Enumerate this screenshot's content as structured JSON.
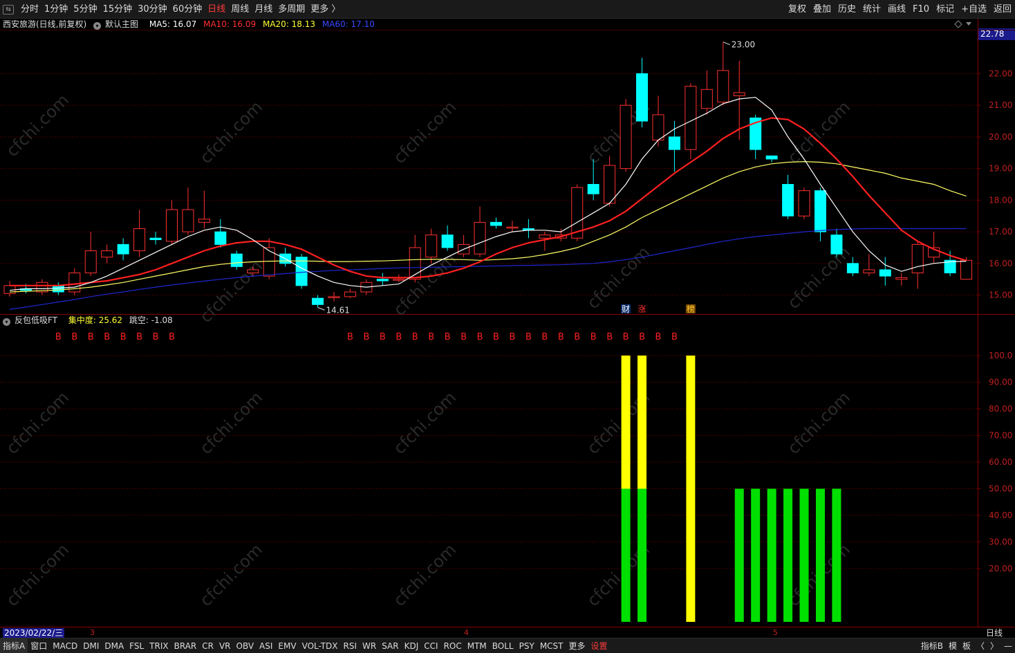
{
  "topbar": {
    "periods": [
      "分时",
      "1分钟",
      "5分钟",
      "15分钟",
      "30分钟",
      "60分钟",
      "日线",
      "周线",
      "月线",
      "多周期",
      "更多 〉"
    ],
    "active_index": 6,
    "right_tools": [
      "复权",
      "叠加",
      "历史",
      "统计",
      "画线",
      "F10",
      "标记",
      "+自选",
      "返回"
    ]
  },
  "main_panel": {
    "stock_title": "西安旅游(日线,前复权)",
    "template_name": "默认主图",
    "ma5": "MA5: 16.07",
    "ma10": "MA10: 16.09",
    "ma20": "MA20: 18.13",
    "ma60": "MA60: 17.10",
    "current_price_tag": "22.78",
    "high_label": "23.00",
    "low_label": "14.61",
    "markers": [
      "财",
      "涨",
      "榜"
    ]
  },
  "indicator_panel": {
    "name": "反包低吸FT",
    "concentration": "集中度: 25.62",
    "gap": "跳空: -1.08",
    "signal_letter": "B"
  },
  "price_axis_ticks": [
    "22.00",
    "21.00",
    "20.00",
    "19.00",
    "18.00",
    "17.00",
    "16.00",
    "15.00"
  ],
  "indicator_axis_ticks": [
    "100.0",
    "90.00",
    "80.00",
    "70.00",
    "60.00",
    "50.00",
    "40.00",
    "30.00",
    "20.00"
  ],
  "datebar": {
    "date": "2023/02/22/三",
    "months": [
      "3",
      "4",
      "5"
    ],
    "period": "日线"
  },
  "bottombar": {
    "tabs": [
      "指标A",
      "窗口",
      "MACD",
      "DMI",
      "DMA",
      "FSL",
      "TRIX",
      "BRAR",
      "CR",
      "VR",
      "OBV",
      "ASI",
      "EMV",
      "VOL-TDX",
      "RSI",
      "WR",
      "SAR",
      "KDJ",
      "CCI",
      "ROC",
      "MTM",
      "BOLL",
      "PSY",
      "MCST",
      "更多",
      "设置"
    ],
    "right": [
      "指标B",
      "模",
      "板",
      "〈",
      "〉",
      "—"
    ]
  },
  "watermark": "cfchi.com",
  "colors": {
    "up": "#ff3030",
    "down": "#00ffff",
    "ma5": "#ffffff",
    "ma10": "#ff2020",
    "ma20": "#ffff66",
    "ma60": "#1e28d0",
    "yellow_bar": "#ffff00",
    "green_bar": "#00e000",
    "grid": "#8b0000"
  },
  "chart_data": [
    {
      "type": "candlestick",
      "title": "西安旅游(日线,前复权)",
      "ylim": [
        14.4,
        23.3
      ],
      "candles": [
        [
          15.05,
          15.3,
          15.45,
          14.95
        ],
        [
          15.2,
          15.15,
          15.35,
          15.05
        ],
        [
          15.1,
          15.4,
          15.5,
          15.0
        ],
        [
          15.3,
          15.1,
          15.4,
          15.0
        ],
        [
          15.1,
          15.7,
          15.85,
          15.0
        ],
        [
          15.7,
          16.4,
          17.0,
          15.6
        ],
        [
          16.2,
          16.4,
          16.6,
          16.0
        ],
        [
          16.6,
          16.3,
          16.8,
          16.1
        ],
        [
          16.4,
          17.1,
          17.7,
          16.2
        ],
        [
          16.8,
          16.75,
          17.0,
          16.6
        ],
        [
          16.7,
          17.7,
          18.0,
          16.6
        ],
        [
          17.0,
          17.7,
          18.4,
          16.9
        ],
        [
          17.3,
          17.4,
          18.3,
          17.1
        ],
        [
          17.0,
          16.6,
          17.4,
          16.5
        ],
        [
          16.3,
          15.9,
          16.4,
          15.8
        ],
        [
          15.7,
          15.8,
          15.9,
          15.6
        ],
        [
          15.6,
          16.5,
          16.8,
          15.5
        ],
        [
          16.3,
          16.0,
          16.5,
          15.9
        ],
        [
          16.2,
          15.3,
          16.3,
          15.2
        ],
        [
          14.9,
          14.7,
          15.0,
          14.61
        ],
        [
          14.95,
          14.95,
          15.1,
          14.8
        ],
        [
          14.95,
          15.1,
          15.2,
          14.9
        ],
        [
          15.1,
          15.4,
          15.5,
          15.0
        ],
        [
          15.5,
          15.45,
          15.7,
          15.3
        ],
        [
          15.5,
          15.5,
          15.65,
          15.4
        ],
        [
          15.5,
          16.5,
          16.9,
          15.4
        ],
        [
          16.2,
          16.9,
          17.1,
          16.0
        ],
        [
          16.9,
          16.5,
          17.2,
          16.4
        ],
        [
          16.3,
          16.6,
          16.9,
          16.2
        ],
        [
          16.3,
          17.3,
          17.8,
          16.2
        ],
        [
          17.3,
          17.2,
          17.45,
          17.1
        ],
        [
          17.15,
          17.15,
          17.35,
          17.0
        ],
        [
          17.1,
          17.05,
          17.4,
          16.8
        ],
        [
          16.8,
          16.9,
          17.0,
          16.4
        ],
        [
          16.8,
          16.9,
          17.1,
          16.7
        ],
        [
          16.8,
          18.4,
          18.5,
          16.7
        ],
        [
          18.5,
          18.2,
          19.3,
          18.0
        ],
        [
          17.9,
          19.1,
          19.4,
          17.8
        ],
        [
          19.0,
          21.0,
          21.2,
          18.9
        ],
        [
          22.0,
          20.5,
          22.5,
          20.3
        ],
        [
          19.9,
          20.7,
          21.3,
          19.7
        ],
        [
          20.0,
          19.6,
          20.5,
          18.9
        ],
        [
          19.6,
          21.6,
          21.7,
          19.3
        ],
        [
          20.9,
          21.5,
          22.1,
          20.7
        ],
        [
          21.1,
          22.1,
          23.0,
          21.0
        ],
        [
          21.3,
          21.4,
          22.4,
          19.9
        ],
        [
          20.6,
          19.6,
          20.7,
          19.3
        ],
        [
          19.4,
          19.3,
          19.4,
          19.2
        ],
        [
          18.5,
          17.5,
          18.8,
          17.4
        ],
        [
          17.5,
          18.3,
          18.4,
          17.4
        ],
        [
          18.3,
          17.0,
          18.4,
          16.7
        ],
        [
          16.9,
          16.3,
          17.1,
          16.2
        ],
        [
          16.0,
          15.7,
          16.2,
          15.6
        ],
        [
          15.7,
          15.8,
          16.3,
          15.6
        ],
        [
          15.8,
          15.6,
          16.2,
          15.3
        ],
        [
          15.5,
          15.55,
          15.7,
          15.3
        ],
        [
          15.7,
          16.6,
          16.7,
          15.2
        ],
        [
          16.2,
          16.5,
          17.0,
          16.0
        ],
        [
          16.1,
          15.7,
          16.4,
          15.6
        ],
        [
          15.5,
          16.1,
          16.2,
          15.5
        ]
      ],
      "ma5": [
        15.15,
        15.2,
        15.2,
        15.22,
        15.25,
        15.4,
        15.6,
        15.85,
        16.1,
        16.35,
        16.6,
        16.85,
        17.05,
        17.15,
        17.05,
        16.75,
        16.4,
        16.15,
        15.85,
        15.6,
        15.4,
        15.3,
        15.25,
        15.3,
        15.35,
        15.65,
        15.95,
        16.2,
        16.45,
        16.65,
        16.85,
        17.0,
        17.05,
        17.05,
        17.0,
        17.3,
        17.6,
        17.9,
        18.5,
        19.3,
        19.9,
        20.25,
        20.5,
        20.75,
        21.05,
        21.2,
        21.25,
        20.85,
        20.0,
        19.3,
        18.5,
        17.75,
        17.0,
        16.4,
        15.95,
        15.75,
        15.9,
        16.0,
        16.05,
        16.07
      ],
      "ma10": [
        15.3,
        15.3,
        15.3,
        15.3,
        15.35,
        15.4,
        15.45,
        15.55,
        15.65,
        15.8,
        16.0,
        16.2,
        16.4,
        16.55,
        16.65,
        16.7,
        16.7,
        16.6,
        16.45,
        16.2,
        15.95,
        15.75,
        15.6,
        15.55,
        15.55,
        15.55,
        15.6,
        15.7,
        15.85,
        16.05,
        16.3,
        16.5,
        16.65,
        16.75,
        16.85,
        17.0,
        17.15,
        17.35,
        17.65,
        18.05,
        18.45,
        18.85,
        19.2,
        19.55,
        19.95,
        20.25,
        20.45,
        20.6,
        20.55,
        20.25,
        19.8,
        19.3,
        18.75,
        18.15,
        17.6,
        17.05,
        16.7,
        16.45,
        16.25,
        16.09
      ],
      "ma20": [
        15.1,
        15.12,
        15.14,
        15.16,
        15.2,
        15.25,
        15.32,
        15.4,
        15.5,
        15.6,
        15.7,
        15.8,
        15.9,
        15.97,
        16.02,
        16.05,
        16.07,
        16.08,
        16.08,
        16.07,
        16.06,
        16.06,
        16.07,
        16.08,
        16.1,
        16.12,
        16.13,
        16.13,
        16.12,
        16.1,
        16.12,
        16.15,
        16.2,
        16.28,
        16.38,
        16.5,
        16.7,
        16.9,
        17.15,
        17.45,
        17.7,
        17.95,
        18.2,
        18.45,
        18.7,
        18.9,
        19.05,
        19.15,
        19.2,
        19.22,
        19.2,
        19.15,
        19.05,
        18.95,
        18.85,
        18.7,
        18.6,
        18.5,
        18.3,
        18.13
      ],
      "ma60": [
        14.55,
        14.62,
        14.7,
        14.78,
        14.86,
        14.95,
        15.03,
        15.1,
        15.18,
        15.25,
        15.32,
        15.38,
        15.44,
        15.5,
        15.55,
        15.6,
        15.64,
        15.68,
        15.72,
        15.75,
        15.78,
        15.8,
        15.82,
        15.84,
        15.86,
        15.87,
        15.88,
        15.89,
        15.9,
        15.91,
        15.92,
        15.93,
        15.94,
        15.95,
        15.96,
        15.98,
        16.0,
        16.05,
        16.12,
        16.2,
        16.3,
        16.4,
        16.5,
        16.6,
        16.7,
        16.78,
        16.85,
        16.9,
        16.95,
        17.0,
        17.04,
        17.07,
        17.09,
        17.1,
        17.1,
        17.1,
        17.1,
        17.1,
        17.1,
        17.1
      ]
    },
    {
      "type": "bar",
      "title": "反包低吸FT",
      "ylim": [
        0,
        100
      ],
      "signal_b_indices": [
        3,
        4,
        5,
        6,
        7,
        8,
        9,
        10,
        21,
        22,
        23,
        24,
        25,
        26,
        27,
        28,
        29,
        30,
        31,
        32,
        33,
        34,
        35,
        36,
        37,
        38,
        39,
        40,
        41
      ],
      "stacked_bars": [
        {
          "index": 38,
          "green": 50,
          "yellow": 50
        },
        {
          "index": 39,
          "green": 50,
          "yellow": 50
        },
        {
          "index": 42,
          "green": 0,
          "yellow": 100
        },
        {
          "index": 45,
          "green": 50,
          "yellow": 0
        },
        {
          "index": 46,
          "green": 50,
          "yellow": 0
        },
        {
          "index": 47,
          "green": 50,
          "yellow": 0
        },
        {
          "index": 48,
          "green": 50,
          "yellow": 0
        },
        {
          "index": 49,
          "green": 50,
          "yellow": 0
        },
        {
          "index": 50,
          "green": 50,
          "yellow": 0
        },
        {
          "index": 51,
          "green": 50,
          "yellow": 0
        }
      ]
    }
  ]
}
